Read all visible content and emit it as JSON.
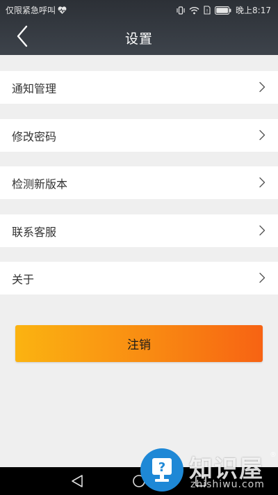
{
  "status_bar": {
    "left_text": "仅限紧急呼叫",
    "time": "晚上8:17",
    "icons": [
      "heart-icon",
      "vibrate-icon",
      "wifi-icon",
      "sim-icon",
      "battery-icon"
    ]
  },
  "nav": {
    "title": "设置",
    "back_icon": "chevron-left-icon"
  },
  "settings": {
    "items": [
      {
        "label": "通知管理",
        "icon": "chevron-right-icon"
      },
      {
        "label": "修改密码",
        "icon": "chevron-right-icon"
      },
      {
        "label": "检测新版本",
        "icon": "chevron-right-icon"
      },
      {
        "label": "联系客服",
        "icon": "chevron-right-icon"
      },
      {
        "label": "关于",
        "icon": "chevron-right-icon"
      }
    ]
  },
  "logout": {
    "label": "注销"
  },
  "system_nav": {
    "icons": [
      "back-triangle-icon",
      "home-circle-icon",
      "recents-square-icon"
    ]
  },
  "watermark": {
    "title": "知识屋",
    "subtitle": "zhishiwu.com",
    "reg": "®"
  },
  "colors": {
    "header": "#2c3036",
    "background": "#efefef",
    "logout_start": "#fbb311",
    "logout_end": "#f76313",
    "watermark_circle": "#1e88d6"
  }
}
